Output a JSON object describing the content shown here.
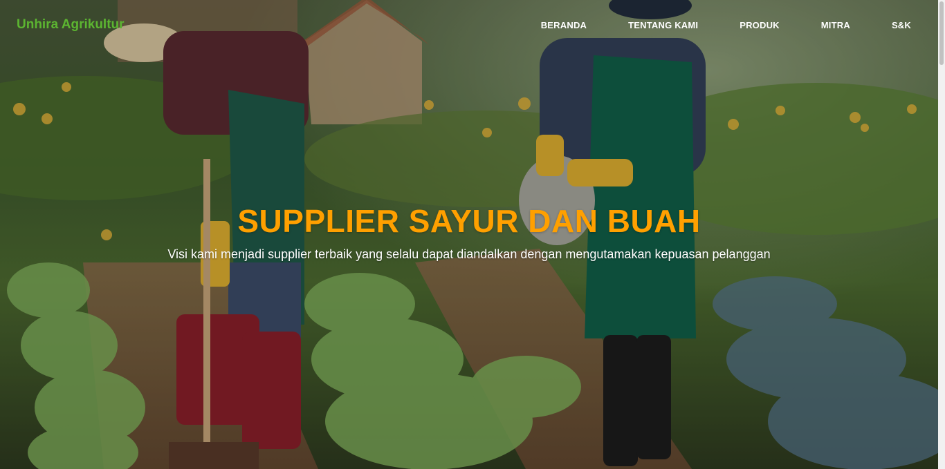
{
  "brand": {
    "name": "Unhira Agrikultur",
    "color": "#5cb531"
  },
  "nav": {
    "items": [
      {
        "label": "BERANDA"
      },
      {
        "label": "TENTANG KAMI"
      },
      {
        "label": "PRODUK"
      },
      {
        "label": "MITRA"
      },
      {
        "label": "S&K"
      }
    ]
  },
  "hero": {
    "title": "SUPPLIER SAYUR DAN BUAH",
    "subtitle": "Visi kami menjadi supplier terbaik yang selalu dapat diandalkan dengan mengutamakan kepuasan pelanggan",
    "title_color": "#ffa000",
    "background": "farm-workers-vegetable-garden-photo"
  }
}
